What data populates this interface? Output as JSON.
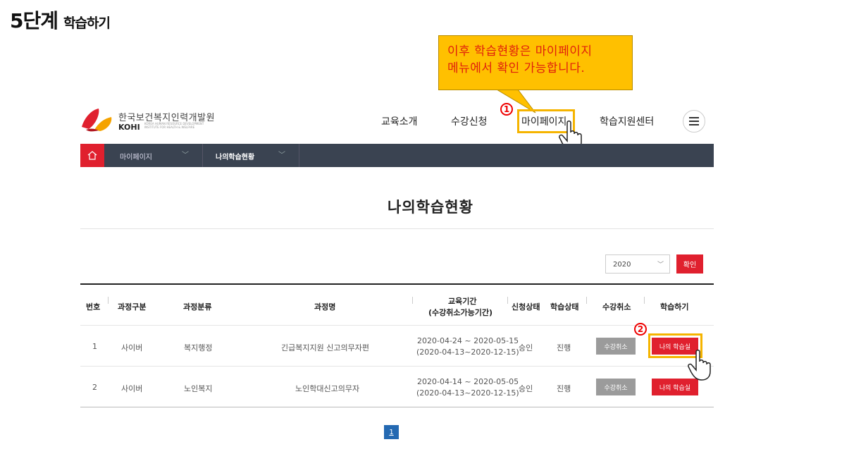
{
  "step": {
    "title": "5단계",
    "subtitle": "학습하기"
  },
  "callout": {
    "line1": "이후  학습현황은  마이페이지",
    "line2": "메뉴에서 확인 가능합니다."
  },
  "markers": {
    "one": "1",
    "two": "2"
  },
  "brand": {
    "name_ko": "한국보건복지인력개발원",
    "name_en": "KOHI",
    "name_en_sub": "KOREA HUMAN RESOURCE DEVELOPMENT INSTITUTE FOR HEALTH & WELFARE"
  },
  "nav": {
    "items": [
      "교육소개",
      "수강신청",
      "마이페이지",
      "학습지원센터"
    ],
    "menu_icon": "hamburger-icon"
  },
  "subnav": {
    "home_icon": "home-icon",
    "items": [
      "마이페이지",
      "나의학습현황"
    ]
  },
  "page": {
    "heading": "나의학습현황"
  },
  "filter": {
    "year": "2020",
    "confirm_label": "확인"
  },
  "table": {
    "headers": [
      "번호",
      "과정구분",
      "과정분류",
      "과정명",
      "교육기간",
      "(수강취소가능기간)",
      "신청상태",
      "학습상태",
      "수강취소",
      "학습하기"
    ],
    "rows": [
      {
        "no": "1",
        "type": "사이버",
        "category": "복지행정",
        "course": "긴급복지지원 신고의무자편",
        "period": "2020-04-24 ~ 2020-05-15",
        "cancel_period": "(2020-04-13~2020-12-15)",
        "apply_status": "승인",
        "study_status": "진행",
        "cancel_label": "수강취소",
        "study_label": "나의 학습실"
      },
      {
        "no": "2",
        "type": "사이버",
        "category": "노인복지",
        "course": "노인학대신고의무자",
        "period": "2020-04-14 ~ 2020-05-05",
        "cancel_period": "(2020-04-13~2020-12-15)",
        "apply_status": "승인",
        "study_status": "진행",
        "cancel_label": "수강취소",
        "study_label": "나의 학습실"
      }
    ]
  },
  "pagination": {
    "current": "1"
  },
  "colors": {
    "accent": "#e0202e",
    "highlight": "#f5b400",
    "callout_bg": "#ffc000",
    "subnav_bg": "#3a4351",
    "pager": "#2469b2"
  }
}
